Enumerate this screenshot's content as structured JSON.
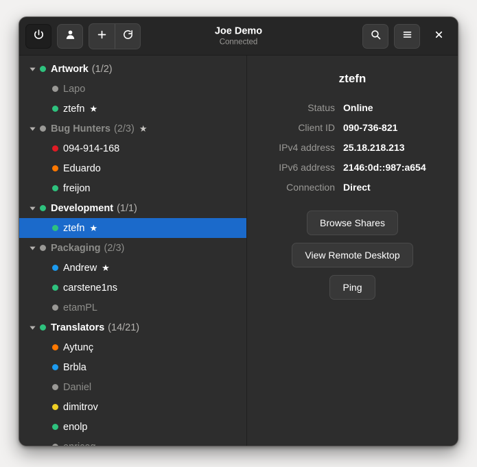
{
  "header": {
    "title": "Joe Demo",
    "subtitle": "Connected",
    "buttons": {
      "power": "power-icon",
      "account": "person-icon",
      "add": "plus-icon",
      "refresh": "refresh-icon",
      "search": "search-icon",
      "menu": "hamburger-menu-icon",
      "close": "close-icon"
    }
  },
  "colors": {
    "online": "#2ec27e",
    "away": "#ff7800",
    "busy": "#e01b24",
    "idle": "#f0d024",
    "blue": "#1c9bf0",
    "offline": "#9a9996",
    "selection": "#1b6acb"
  },
  "sidebar": {
    "groups": [
      {
        "name": "Artwork",
        "count": "(1/2)",
        "dot": "online",
        "muted": false,
        "starred": false,
        "expanded": true,
        "members": [
          {
            "name": "Lapo",
            "dot": "offline",
            "offline": true,
            "starred": false,
            "selected": false
          },
          {
            "name": "ztefn",
            "dot": "online",
            "offline": false,
            "starred": true,
            "selected": false
          }
        ]
      },
      {
        "name": "Bug Hunters",
        "count": "(2/3)",
        "dot": "offline",
        "muted": true,
        "starred": true,
        "expanded": true,
        "members": [
          {
            "name": "094-914-168",
            "dot": "busy",
            "offline": false,
            "starred": false,
            "selected": false
          },
          {
            "name": "Eduardo",
            "dot": "away",
            "offline": false,
            "starred": false,
            "selected": false
          },
          {
            "name": "freijon",
            "dot": "online",
            "offline": false,
            "starred": false,
            "selected": false
          }
        ]
      },
      {
        "name": "Development",
        "count": "(1/1)",
        "dot": "online",
        "muted": false,
        "starred": false,
        "expanded": true,
        "members": [
          {
            "name": "ztefn",
            "dot": "online",
            "offline": false,
            "starred": true,
            "selected": true
          }
        ]
      },
      {
        "name": "Packaging",
        "count": "(2/3)",
        "dot": "offline",
        "muted": true,
        "starred": false,
        "expanded": true,
        "members": [
          {
            "name": "Andrew",
            "dot": "blue",
            "offline": false,
            "starred": true,
            "selected": false
          },
          {
            "name": "carstene1ns",
            "dot": "online",
            "offline": false,
            "starred": false,
            "selected": false
          },
          {
            "name": "etamPL",
            "dot": "offline",
            "offline": true,
            "starred": false,
            "selected": false
          }
        ]
      },
      {
        "name": "Translators",
        "count": "(14/21)",
        "dot": "online",
        "muted": false,
        "starred": false,
        "expanded": true,
        "members": [
          {
            "name": "Aytunç",
            "dot": "away",
            "offline": false,
            "starred": false,
            "selected": false
          },
          {
            "name": "Brbla",
            "dot": "blue",
            "offline": false,
            "starred": false,
            "selected": false
          },
          {
            "name": "Daniel",
            "dot": "offline",
            "offline": true,
            "starred": false,
            "selected": false
          },
          {
            "name": "dimitrov",
            "dot": "idle",
            "offline": false,
            "starred": false,
            "selected": false
          },
          {
            "name": "enolp",
            "dot": "online",
            "offline": false,
            "starred": false,
            "selected": false
          },
          {
            "name": "enricog",
            "dot": "offline",
            "offline": true,
            "starred": false,
            "selected": false
          }
        ]
      }
    ]
  },
  "detail": {
    "title": "ztefn",
    "properties": [
      {
        "key": "Status",
        "value": "Online"
      },
      {
        "key": "Client ID",
        "value": "090-736-821"
      },
      {
        "key": "IPv4 address",
        "value": "25.18.218.213"
      },
      {
        "key": "IPv6 address",
        "value": "2146:0d::987:a654"
      },
      {
        "key": "Connection",
        "value": "Direct"
      }
    ],
    "actions": [
      {
        "label": "Browse Shares"
      },
      {
        "label": "View Remote Desktop"
      },
      {
        "label": "Ping"
      }
    ]
  }
}
